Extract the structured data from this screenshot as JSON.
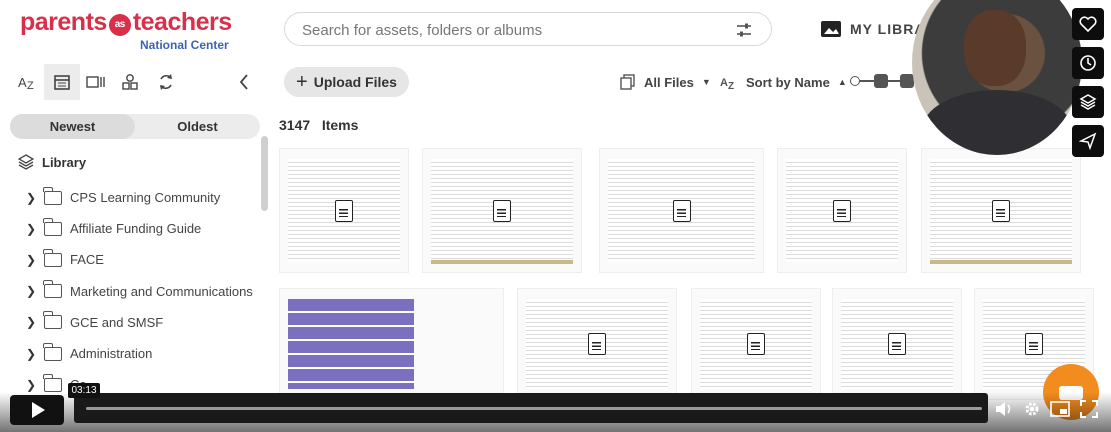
{
  "brand": {
    "logo_main_left": "parents",
    "logo_as": "as",
    "logo_main_right": "teachers",
    "logo_sub": "National Center"
  },
  "search": {
    "placeholder": "Search for assets, folders or albums"
  },
  "header": {
    "my_library": "MY LIBRARY"
  },
  "left_toolbar": {
    "icons": [
      "az-sort-icon",
      "calendar-icon",
      "list-view-icon",
      "shapes-icon",
      "refresh-icon",
      "collapse-left-icon"
    ]
  },
  "left_panel": {
    "sort_newest": "Newest",
    "sort_oldest": "Oldest",
    "library_label": "Library",
    "folders": [
      "CPS Learning Community",
      "Affiliate Funding Guide",
      "FACE",
      "Marketing and Communications",
      "GCE and SMSF",
      "Administration",
      "Ca..."
    ]
  },
  "main": {
    "upload_label": "Upload Files",
    "all_files_label": "All Files",
    "sort_label": "Sort by Name",
    "item_count": "3147",
    "items_label": "Items"
  },
  "video": {
    "time": "03:13"
  },
  "colors": {
    "brand_red": "#d9304a",
    "brand_blue": "#3a64b5",
    "accent_orange": "#f28c1e"
  }
}
